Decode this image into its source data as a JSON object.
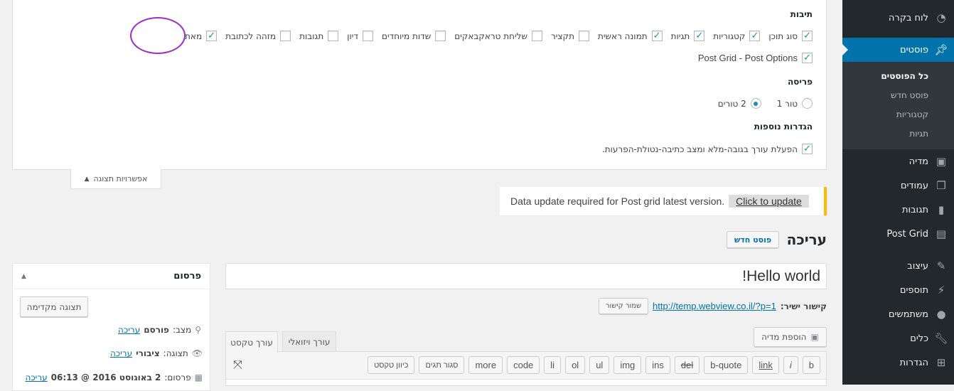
{
  "sidebar": {
    "items": [
      {
        "label": "לוח בקרה",
        "icon": "dashboard-icon"
      },
      {
        "label": "פוסטים",
        "icon": "pin-icon",
        "active": true
      },
      {
        "label": "מדיה",
        "icon": "media-icon"
      },
      {
        "label": "עמודים",
        "icon": "pages-icon"
      },
      {
        "label": "תגובות",
        "icon": "comments-icon"
      },
      {
        "label": "Post Grid",
        "icon": "grid-icon"
      },
      {
        "label": "עיצוב",
        "icon": "appearance-icon"
      },
      {
        "label": "תוספים",
        "icon": "plugins-icon"
      },
      {
        "label": "משתמשים",
        "icon": "users-icon"
      },
      {
        "label": "כלים",
        "icon": "tools-icon"
      },
      {
        "label": "הגדרות",
        "icon": "settings-icon"
      }
    ],
    "submenu": [
      "כל הפוסטים",
      "פוסט חדש",
      "קטגוריות",
      "תגיות"
    ]
  },
  "screen_options": {
    "boxes_heading": "תיבות",
    "boxes": [
      {
        "label": "סוג תוכן",
        "checked": true
      },
      {
        "label": "קטגוריות",
        "checked": true
      },
      {
        "label": "תגיות",
        "checked": true
      },
      {
        "label": "תמונה ראשית",
        "checked": true
      },
      {
        "label": "תקציר",
        "checked": false
      },
      {
        "label": "שליחת טראקבאקים",
        "checked": false
      },
      {
        "label": "שדות מיוחדים",
        "checked": false
      },
      {
        "label": "דיון",
        "checked": false
      },
      {
        "label": "תגובות",
        "checked": false
      },
      {
        "label": "מזהה לכתובת",
        "checked": false
      },
      {
        "label": "מאת",
        "checked": true
      }
    ],
    "post_grid_option": {
      "label": "Post Grid - Post Options",
      "checked": true
    },
    "layout_heading": "פריסה",
    "layout": [
      {
        "label": "טור 1",
        "selected": false
      },
      {
        "label": "2 טורים",
        "selected": true
      }
    ],
    "additional_heading": "הגדרות נוספות",
    "additional": {
      "label": "הפעלת עורך בגובה-מלא ומצב כתיבה-נטולת-הפרעות.",
      "checked": true
    },
    "tab_label": "אפשרויות תצוגה"
  },
  "notice": {
    "text": "Data update required for Post grid latest version.",
    "button": "Click to update",
    "accent": "#ffb900"
  },
  "page": {
    "heading": "עריכה",
    "new_post": "פוסט חדש"
  },
  "editor": {
    "title": "Hello world!",
    "permalink_label": "קישור ישיר:",
    "permalink_url": "http://temp.webview.co.il/?p=1",
    "save_link": "שמור קישור",
    "add_media": "הוספת מדיה",
    "tab_text": "עורך טקסט",
    "tab_visual": "עורך ויזואלי",
    "quicktags": [
      "b",
      "i",
      "link",
      "b-quote",
      "del",
      "ins",
      "img",
      "ul",
      "ol",
      "li",
      "code",
      "more",
      "סגור תגים",
      "כיוון טקסט"
    ]
  },
  "publish": {
    "title": "פרסום",
    "preview": "תצוגה מקדימה",
    "status_label": "מצב:",
    "status_value": "פורסם",
    "visibility_label": "תצוגה:",
    "visibility_value": "ציבורי",
    "published_label": "פרסום:",
    "published_value": "2 באוגוסט 2016 @ 06:13",
    "edit": "עריכה"
  },
  "colors": {
    "sidebar": "#23282d",
    "active": "#0073aa",
    "link": "#0073aa",
    "highlight": "#9b2fc9"
  }
}
